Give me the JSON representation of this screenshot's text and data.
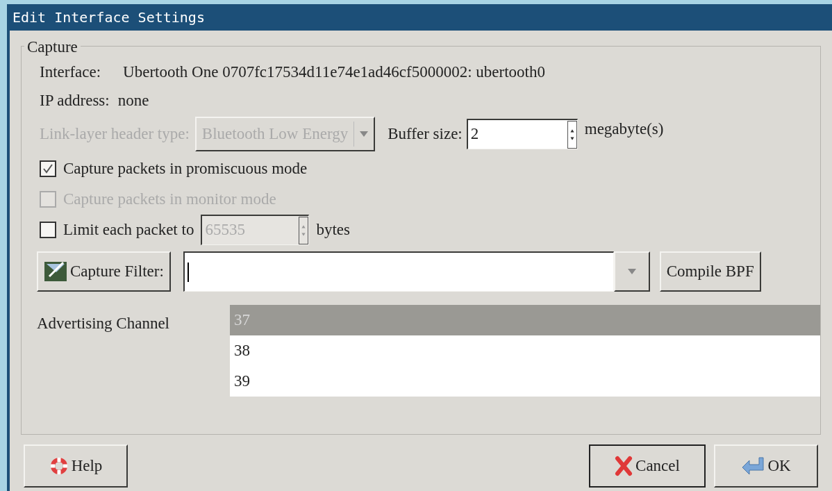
{
  "window": {
    "title": "Edit Interface Settings"
  },
  "capture": {
    "legend": "Capture",
    "interface_label": "Interface:",
    "interface_value": "Ubertooth One 0707fc17534d11e74e1ad46cf5000002: ubertooth0",
    "ip_label": "IP address:",
    "ip_value": "none",
    "link_layer": {
      "label": "Link-layer header type:",
      "value": "Bluetooth Low Energy",
      "disabled": true
    },
    "buffer": {
      "label": "Buffer size:",
      "value": "2",
      "unit": "megabyte(s)"
    },
    "options": [
      {
        "kind": "check",
        "label": "Capture packets in promiscuous mode",
        "checked": true,
        "disabled": false
      },
      {
        "kind": "check",
        "label": "Capture packets in monitor mode",
        "checked": false,
        "disabled": true
      },
      {
        "kind": "limit",
        "label": "Limit each packet to",
        "checked": false,
        "disabled": false,
        "value": "65535",
        "value_disabled": true,
        "unit": "bytes"
      }
    ],
    "filter": {
      "button": "Capture Filter:",
      "compile": "Compile BPF"
    },
    "channel": {
      "label": "Advertising Channel",
      "items": [
        {
          "label": "37",
          "selected": true
        },
        {
          "label": "38",
          "selected": false
        },
        {
          "label": "39",
          "selected": false
        }
      ]
    }
  },
  "buttons": {
    "help": "Help",
    "cancel": "Cancel",
    "ok": "OK"
  }
}
